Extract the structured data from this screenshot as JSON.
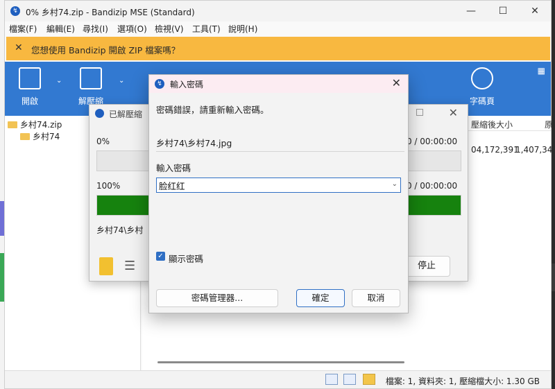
{
  "window": {
    "title": "0% 乡村74.zip - Bandizip MSE (Standard)"
  },
  "menu": [
    "檔案(F)",
    "編輯(E)",
    "尋找(I)",
    "選項(O)",
    "檢視(V)",
    "工具(T)",
    "說明(H)"
  ],
  "banner": {
    "text": "您想使用 Bandizip 開啟 ZIP 檔案嗎？"
  },
  "toolbar": {
    "open_label": "開啟",
    "extract_label": "解壓縮",
    "codepage_label": "字碼頁"
  },
  "tree": {
    "archive": "乡村74.zip",
    "folder": "乡村74"
  },
  "list": {
    "col_compressed": "壓縮後大小",
    "col_original": "原",
    "row_compressed": "04,172,391",
    "row_original": "1,407,34"
  },
  "status": {
    "text": "檔案: 1, 資料夾: 1, 壓縮檔大小: 1.30 GB"
  },
  "extract_dialog": {
    "title": "已解壓縮",
    "pct_top": "0%",
    "time_top": "00:00 / 00:00:00",
    "pct_bottom": "100%",
    "time_bottom": "00:00 / 00:00:00",
    "progress_top": 0,
    "progress_bottom": 1,
    "current_file": "乡村74\\乡村",
    "stop_label": "停止"
  },
  "password_dialog": {
    "title": "輸入密碼",
    "error": "密碼錯誤，請重新輸入密碼。",
    "file": "乡村74\\乡村74.jpg",
    "label": "輸入密碼",
    "value": "脸红红",
    "show_password": "顯示密碼",
    "manager_button": "密碼管理器...",
    "ok_button": "確定",
    "cancel_button": "取消"
  }
}
